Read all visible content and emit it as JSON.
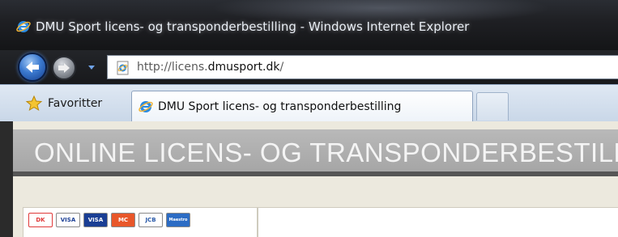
{
  "window": {
    "title": "DMU Sport licens- og transponderbestilling - Windows Internet Explorer"
  },
  "navigation": {
    "url_prefix": "http://licens.",
    "url_domain": "dmusport.dk",
    "url_suffix": "/"
  },
  "favorites": {
    "label": "Favoritter"
  },
  "tabs": [
    {
      "label": "DMU Sport licens- og transponderbestilling",
      "active": true
    }
  ],
  "page": {
    "banner_title": "ONLINE LICENS- OG TRANSPONDERBESTILLING",
    "payment_cards": [
      {
        "label": "DK",
        "color": "#e03a3a",
        "bg": "#ffffff",
        "fg": "#e03a3a"
      },
      {
        "label": "VISA",
        "color": "#1a3e94",
        "bg": "#ffffff",
        "fg": "#1a3e94"
      },
      {
        "label": "VISA",
        "color": "#1a3e94",
        "bg": "#1a3e94",
        "fg": "#ffffff"
      },
      {
        "label": "MC",
        "color": "#e8572a",
        "bg": "#e8572a",
        "fg": "#ffffff"
      },
      {
        "label": "JCB",
        "color": "#2a5aa8",
        "bg": "#ffffff",
        "fg": "#2a5aa8"
      },
      {
        "label": "Maestro",
        "color": "#2c6cc4",
        "bg": "#2c6cc4",
        "fg": "#ffffff"
      }
    ]
  },
  "colors": {
    "banner": "#b0b0b0",
    "page_background": "#ece9de",
    "ie_blue": "#2a6fd6"
  }
}
